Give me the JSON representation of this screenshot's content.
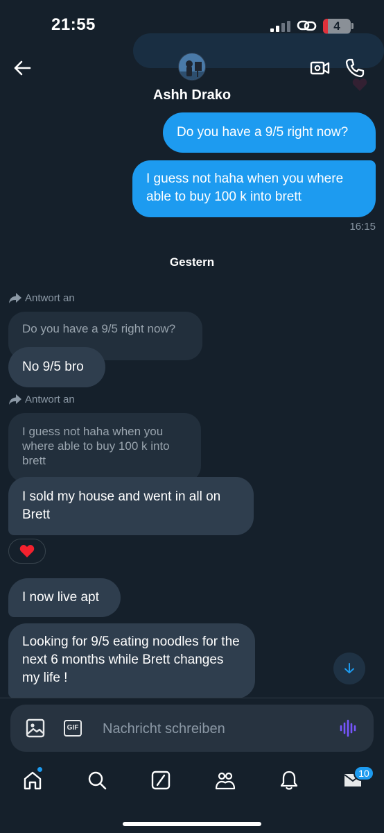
{
  "status_bar": {
    "time": "21:55",
    "battery_level": "4",
    "signal_bars": 2
  },
  "header": {
    "contact_name": "Ashh Drako",
    "icons": [
      "back-arrow-icon",
      "video-camera-icon",
      "phone-icon"
    ]
  },
  "messages": {
    "sent": [
      {
        "text": "Do you have a 9/5 right now?"
      },
      {
        "text": "I guess not haha when you where able to buy 100 k into brett"
      }
    ],
    "sent_time": "16:15",
    "day_separator": "Gestern",
    "reply_label": "Antwort an",
    "received": [
      {
        "reply_to": "Do you have a 9/5 right now?",
        "text": "No 9/5 bro"
      },
      {
        "reply_to": "I guess not haha when you where able to buy 100 k into brett",
        "text": "I sold my house and went in all on Brett",
        "reaction": "❤️"
      },
      {
        "text": "I now live apt"
      },
      {
        "text": "Looking for 9/5 eating noodles for the next 6 months while Brett changes my life !"
      }
    ]
  },
  "composer": {
    "placeholder": "Nachricht schreiben",
    "gif_label": "GIF",
    "value": ""
  },
  "bottom_nav": {
    "items": [
      "home",
      "search",
      "grok",
      "communities",
      "notifications",
      "messages"
    ],
    "messages_badge": "10"
  },
  "colors": {
    "background": "#15202b",
    "sent_bubble": "#1d9bf0",
    "received_bubble": "#2f3e4e",
    "accent": "#1d9bf0",
    "voice_icon": "#7856ff"
  }
}
